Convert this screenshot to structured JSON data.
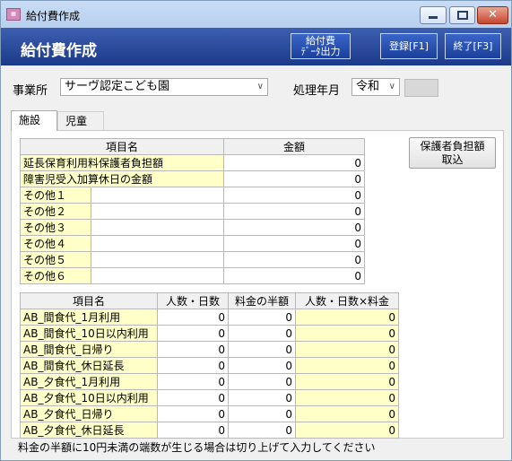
{
  "window": {
    "title": "給付費作成",
    "icon": "app-icon",
    "close_glyph": "✕"
  },
  "header": {
    "title": "給付費作成",
    "export_line1": "給付費",
    "export_line2": "ﾃﾞｰﾀ出力",
    "register_label": "登録[F1]",
    "close_label": "終了[F3]",
    "accent_color": "#1b3a89"
  },
  "filters": {
    "office_label": "事業所",
    "office_value": "サーヴ認定こども園",
    "period_label": "処理年月",
    "era_value": "令和"
  },
  "tabs": [
    "施設",
    "児童"
  ],
  "table1": {
    "headers": [
      "項目名",
      "金額"
    ],
    "rows": [
      {
        "name": "延長保育利用料保護者負担額",
        "value": "0"
      },
      {
        "name": "障害児受入加算休日の金額",
        "value": "0"
      },
      {
        "name": "その他１",
        "value": "0"
      },
      {
        "name": "その他２",
        "value": "0"
      },
      {
        "name": "その他３",
        "value": "0"
      },
      {
        "name": "その他４",
        "value": "0"
      },
      {
        "name": "その他５",
        "value": "0"
      },
      {
        "name": "その他６",
        "value": "0"
      }
    ]
  },
  "guardian_button": {
    "line1": "保護者負担額",
    "line2": "取込"
  },
  "table2": {
    "headers": [
      "項目名",
      "人数・日数",
      "料金の半額",
      "人数・日数×料金"
    ],
    "rows": [
      {
        "name": "AB_間食代_1月利用",
        "count": "0",
        "half": "0",
        "total": "0"
      },
      {
        "name": "AB_間食代_10日以内利用",
        "count": "0",
        "half": "0",
        "total": "0"
      },
      {
        "name": "AB_間食代_日帰り",
        "count": "0",
        "half": "0",
        "total": "0"
      },
      {
        "name": "AB_間食代_休日延長",
        "count": "0",
        "half": "0",
        "total": "0"
      },
      {
        "name": "AB_夕食代_1月利用",
        "count": "0",
        "half": "0",
        "total": "0"
      },
      {
        "name": "AB_夕食代_10日以内利用",
        "count": "0",
        "half": "0",
        "total": "0"
      },
      {
        "name": "AB_夕食代_日帰り",
        "count": "0",
        "half": "0",
        "total": "0"
      },
      {
        "name": "AB_夕食代_休日延長",
        "count": "0",
        "half": "0",
        "total": "0"
      }
    ]
  },
  "note": "料金の半額に10円未満の端数が生じる場合は切り上げて入力してください"
}
